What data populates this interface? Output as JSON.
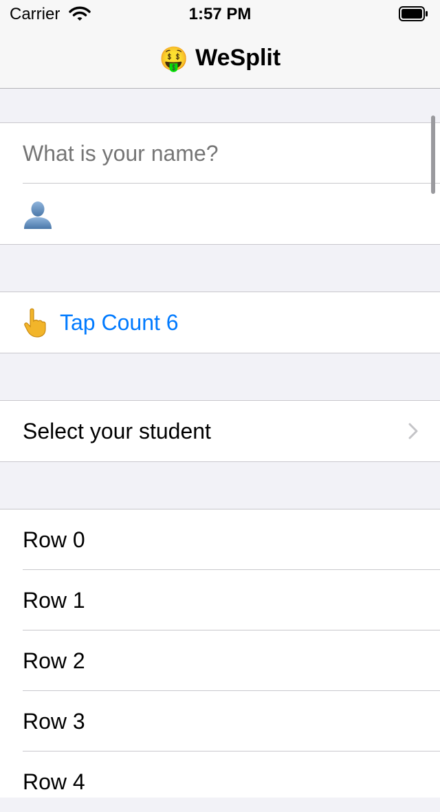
{
  "status_bar": {
    "carrier": "Carrier",
    "time": "1:57 PM",
    "wifi_icon": "wifi-icon",
    "battery_icon": "battery-full-icon"
  },
  "nav": {
    "title_emoji": "🤑",
    "title": "WeSplit"
  },
  "form": {
    "name_field": {
      "placeholder": "What is your name?",
      "value": ""
    },
    "avatar_icon": "person-silhouette-icon",
    "tap_button": {
      "icon": "pointing-up-hand-icon",
      "label": "Tap Count 6"
    },
    "student_picker": {
      "label": "Select your student",
      "chevron_icon": "chevron-right-icon"
    },
    "rows": [
      "Row 0",
      "Row 1",
      "Row 2",
      "Row 3",
      "Row 4"
    ]
  },
  "colors": {
    "accent": "#007aff",
    "grouped_background": "#f2f2f7",
    "separator": "#c8c7cc",
    "placeholder": "#c4c4c6"
  }
}
